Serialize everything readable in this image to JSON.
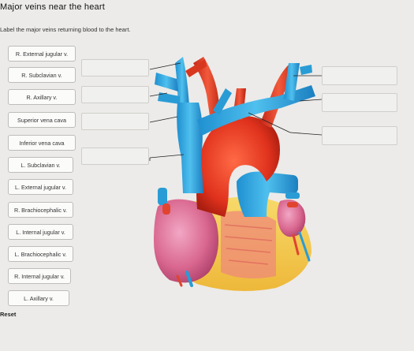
{
  "page": {
    "title": "Major veins near the heart",
    "instructions": "Label the major veins returning blood to the heart.",
    "reset_label": "Reset"
  },
  "labels": [
    "R. External jugular v.",
    "R. Subclavian v.",
    "R. Axillary v.",
    "Superior vena cava",
    "Inferior vena cava",
    "L. Subclavian v.",
    "L. External jugular v.",
    "R. Brachiocephalic v.",
    "L. Internal jugular v.",
    "L. Brachiocephalic v.",
    "R. Internal jugular v.",
    "L. Axillary v."
  ],
  "colors": {
    "vein": "#2aa5dc",
    "artery": "#e03a2b",
    "heart_muscle": "#e07a8a",
    "fat": "#f2c84b",
    "background": "#ecebe9"
  }
}
